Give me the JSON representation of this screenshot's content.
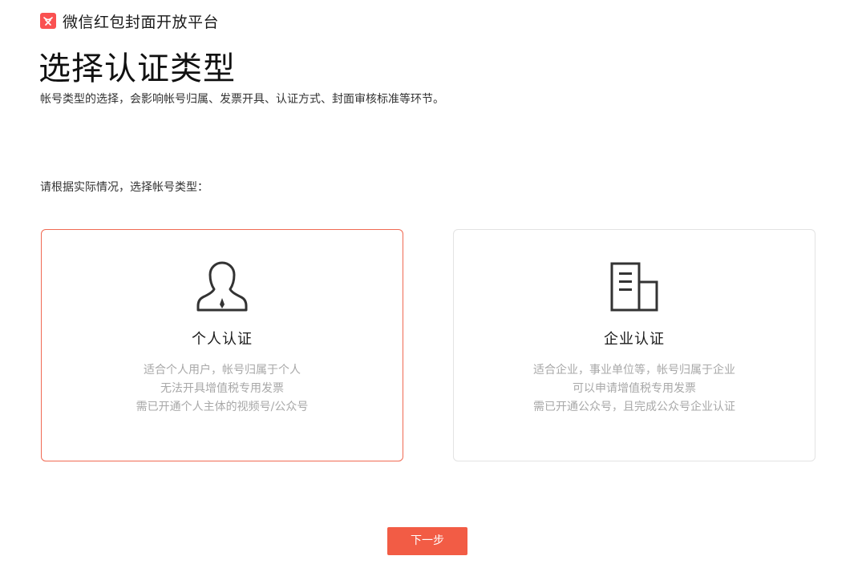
{
  "header": {
    "brand_icon": "red-packet-logo-icon",
    "brand_color": "#fa5151",
    "brand_name": "微信红包封面开放平台"
  },
  "page": {
    "title": "选择认证类型",
    "subtitle": "帐号类型的选择，会影响帐号归属、发票开具、认证方式、封面审核标准等环节。",
    "prompt": "请根据实际情况，选择帐号类型："
  },
  "cards": [
    {
      "icon": "person-icon",
      "title": "个人认证",
      "selected": true,
      "desc": [
        "适合个人用户，帐号归属于个人",
        "无法开具增值税专用发票",
        "需已开通个人主体的视频号/公众号"
      ]
    },
    {
      "icon": "building-icon",
      "title": "企业认证",
      "selected": false,
      "desc": [
        "适合企业，事业单位等，帐号归属于企业",
        "可以申请增值税专用发票",
        "需已开通公众号，且完成公众号企业认证"
      ]
    }
  ],
  "actions": {
    "next_label": "下一步",
    "accent_color": "#f25c45"
  }
}
